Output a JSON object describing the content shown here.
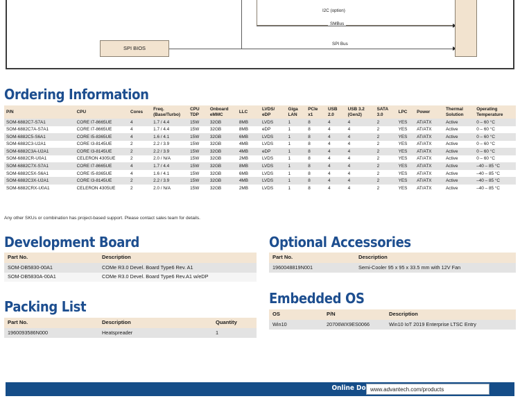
{
  "diagram": {
    "boxes": [
      {
        "name": "spi-bios",
        "label": "SPI BIOS"
      },
      {
        "name": "connector-strip",
        "label": ""
      }
    ],
    "bus_labels": [
      {
        "name": "i2c-option",
        "label": "I2C (option)"
      },
      {
        "name": "smbus",
        "label": "SMBus"
      },
      {
        "name": "spi-bus",
        "label": "SPI Bus"
      }
    ]
  },
  "ordering": {
    "heading": "Ordering Information",
    "columns": [
      "P/N",
      "CPU",
      "Cores",
      "Freq.\n(Base/Turbo)",
      "CPU\nTDP",
      "Onboard\neMMC",
      "LLC",
      "LVDS/\neDP",
      "Giga\nLAN",
      "PCIe\nx1",
      "USB\n2.0",
      "USB 3.2\n(Gen2)",
      "SATA\n3.0",
      "LPC",
      "Power",
      "Thermal\nSolution",
      "Operating\nTemperature"
    ],
    "rows": [
      [
        "SOM-6882C7-S7A1",
        "CORE I7-8665UE",
        "4",
        "1.7 / 4.4",
        "15W",
        "32GB",
        "8MB",
        "LVDS",
        "1",
        "8",
        "4",
        "4",
        "2",
        "YES",
        "AT/ATX",
        "Active",
        "0 – 60 °C"
      ],
      [
        "SOM-6882C7A-S7A1",
        "CORE I7-8665UE",
        "4",
        "1.7 / 4.4",
        "15W",
        "32GB",
        "8MB",
        "eDP",
        "1",
        "8",
        "4",
        "4",
        "2",
        "YES",
        "AT/ATX",
        "Active",
        "0 – 60 °C"
      ],
      [
        "SOM-6882C5-S6A1",
        "CORE I5-8365UE",
        "4",
        "1.6 / 4.1",
        "15W",
        "32GB",
        "6MB",
        "LVDS",
        "1",
        "8",
        "4",
        "4",
        "2",
        "YES",
        "AT/ATX",
        "Active",
        "0 – 60 °C"
      ],
      [
        "SOM-6882C3-U2A1",
        "CORE I3-8145UE",
        "2",
        "2.2 / 3.9",
        "15W",
        "32GB",
        "4MB",
        "LVDS",
        "1",
        "8",
        "4",
        "4",
        "2",
        "YES",
        "AT/ATX",
        "Active",
        "0 – 60 °C"
      ],
      [
        "SOM-6882C3A-U2A1",
        "CORE I3-8145UE",
        "2",
        "2.2 / 3.9",
        "15W",
        "32GB",
        "4MB",
        "eDP",
        "1",
        "8",
        "4",
        "4",
        "2",
        "YES",
        "AT/ATX",
        "Active",
        "0 – 60 °C"
      ],
      [
        "SOM-6882CR-U0A1",
        "CELERON 4305UE",
        "2",
        "2.0 / N/A",
        "15W",
        "32GB",
        "2MB",
        "LVDS",
        "1",
        "8",
        "4",
        "4",
        "2",
        "YES",
        "AT/ATX",
        "Active",
        "0 – 60 °C"
      ],
      [
        "SOM-6882C7X-S7A1",
        "CORE I7-8665UE",
        "4",
        "1.7 / 4.4",
        "15W",
        "32GB",
        "8MB",
        "LVDS",
        "1",
        "8",
        "4",
        "4",
        "2",
        "YES",
        "AT/ATX",
        "Active",
        "–40 – 85 °C"
      ],
      [
        "SOM-6882C5X-S6A1",
        "CORE I5-8365UE",
        "4",
        "1.6 / 4.1",
        "15W",
        "32GB",
        "6MB",
        "LVDS",
        "1",
        "8",
        "4",
        "4",
        "2",
        "YES",
        "AT/ATX",
        "Active",
        "–40 – 85 °C"
      ],
      [
        "SOM-6882C3X-U2A1",
        "CORE I3-8145UE",
        "2",
        "2.2 / 3.9",
        "15W",
        "32GB",
        "4MB",
        "LVDS",
        "1",
        "8",
        "4",
        "4",
        "2",
        "YES",
        "AT/ATX",
        "Active",
        "–40 – 85 °C"
      ],
      [
        "SOM-6882CRX-U0A1",
        "CELERON 4305UE",
        "2",
        "2.0 / N/A",
        "15W",
        "32GB",
        "2MB",
        "LVDS",
        "1",
        "8",
        "4",
        "4",
        "2",
        "YES",
        "AT/ATX",
        "Active",
        "–40 – 85 °C"
      ]
    ],
    "note": "Any other SKUs or combination has project-based support. Please contact sales team for details."
  },
  "development_board": {
    "heading": "Development Board",
    "columns": [
      "Part No.",
      "Description"
    ],
    "rows": [
      [
        "SOM-DB5830-00A1",
        "COMe R3.0 Devel. Board Type6 Rev. A1"
      ],
      [
        "SOM-DB5830A-00A1",
        "COMe R3.0 Devel. Board Type6 Rev.A1 w/eDP"
      ]
    ]
  },
  "packing_list": {
    "heading": "Packing List",
    "columns": [
      "Part No.",
      "Description",
      "Quantity"
    ],
    "rows": [
      [
        "1960093586N000",
        "Heatspreader",
        "1"
      ]
    ]
  },
  "optional_accessories": {
    "heading": "Optional Accessories",
    "columns": [
      "Part No.",
      "Description"
    ],
    "rows": [
      [
        "1960048819N001",
        "Semi-Cooler 95 x 95 x 33.5 mm with 12V Fan"
      ]
    ]
  },
  "embedded_os": {
    "heading": "Embedded OS",
    "columns": [
      "OS",
      "P/N",
      "Description"
    ],
    "rows": [
      [
        "Win10",
        "20706WX9ES0066",
        "Win10 IoT 2019 Enterprise LTSC Entry"
      ]
    ]
  },
  "footer": {
    "label": "Online Download",
    "url": "www.advantech.com/products"
  },
  "colors": {
    "brand_blue": "#1d4e8f",
    "footer_blue": "#154d88",
    "table_header": "#f3e5d3",
    "row_alt": "#e3e3e3",
    "diagram_box": "#f2e3cf"
  }
}
